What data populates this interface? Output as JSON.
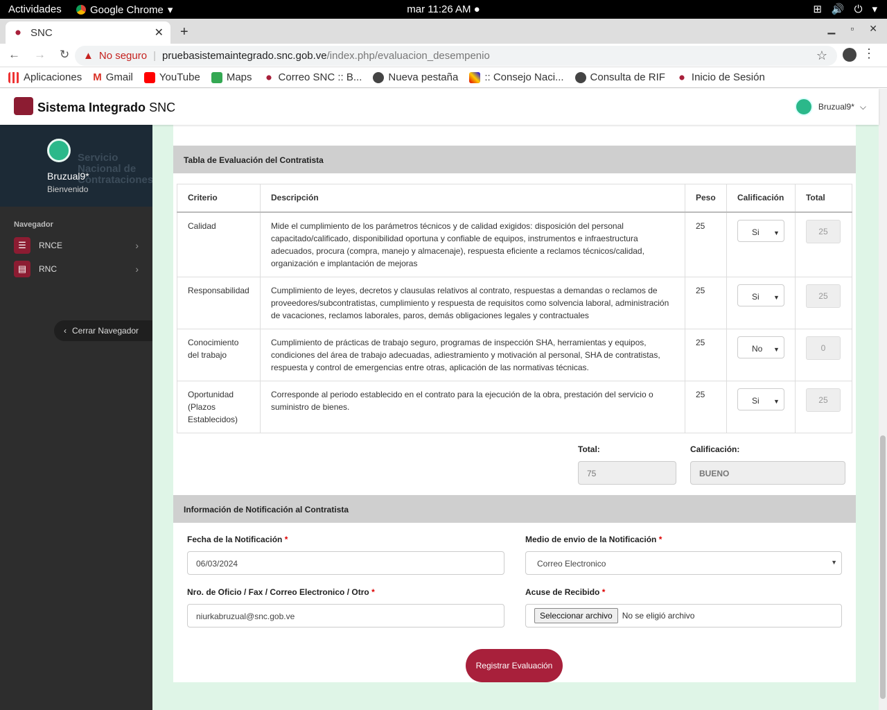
{
  "os": {
    "activities": "Actividades",
    "app_name": "Google Chrome",
    "clock": "mar 11:26 AM"
  },
  "browser": {
    "tab_title": "SNC",
    "security": "No seguro",
    "host": "pruebasistemaintegrado.snc.gob.ve",
    "path": "/index.php/evaluacion_desempenio",
    "bookmarks": [
      "Aplicaciones",
      "Gmail",
      "YouTube",
      "Maps",
      "Correo SNC :: B...",
      "Nueva pestaña",
      ":: Consejo Naci...",
      "Consulta de RIF",
      "Inicio de Sesión"
    ]
  },
  "app": {
    "brand_bold": "Sistema Integrado",
    "brand_rest": "SNC",
    "user": "Bruzual9*"
  },
  "sidebar": {
    "bg_text": [
      "Servicio",
      "Nacional de",
      "Contrataciones"
    ],
    "name": "Bruzual9*",
    "welcome": "Bienvenido",
    "nav_label": "Navegador",
    "items": [
      {
        "label": "RNCE"
      },
      {
        "label": "RNC"
      }
    ],
    "close": "Cerrar Navegador"
  },
  "eval": {
    "title": "Tabla de Evaluación del Contratista",
    "headers": [
      "Criterio",
      "Descripción",
      "Peso",
      "Calificación",
      "Total"
    ],
    "rows": [
      {
        "criterio": "Calidad",
        "descripcion": "Mide el cumplimiento de los parámetros técnicos y de calidad exigidos: disposición del personal capacitado/calificado, disponibilidad oportuna y confiable de equipos, instrumentos e infraestructura adecuados, procura (compra, manejo y almacenaje), respuesta eficiente a reclamos técnicos/calidad, organización e implantación de mejoras",
        "peso": "25",
        "calificacion": "Si",
        "total": "25"
      },
      {
        "criterio": "Responsabilidad",
        "descripcion": "Cumplimiento de leyes, decretos y clausulas relativos al contrato, respuestas a demandas o reclamos de proveedores/subcontratistas, cumplimiento y respuesta de requisitos como solvencia laboral, administración de vacaciones, reclamos laborales, paros, demás obligaciones legales y contractuales",
        "peso": "25",
        "calificacion": "Si",
        "total": "25"
      },
      {
        "criterio": "Conocimiento del trabajo",
        "descripcion": "Cumplimiento de prácticas de trabajo seguro, programas de inspección SHA, herramientas y equipos, condiciones del área de trabajo adecuadas, adiestramiento y motivación al personal, SHA de contratistas, respuesta y control de emergencias entre otras, aplicación de las normativas técnicas.",
        "peso": "25",
        "calificacion": "No",
        "total": "0"
      },
      {
        "criterio": "Oportunidad (Plazos Establecidos)",
        "descripcion": "Corresponde al periodo establecido en el contrato para la ejecución de la obra, prestación del servicio o suministro de bienes.",
        "peso": "25",
        "calificacion": "Si",
        "total": "25"
      }
    ],
    "total_label": "Total:",
    "total_value": "75",
    "grade_label": "Calificación:",
    "grade_value": "BUENO"
  },
  "notif": {
    "title": "Información de Notificación al Contratista",
    "date_label": "Fecha de la Notificación",
    "date_value": "06/03/2024",
    "medium_label": "Medio de envio de la Notificación",
    "medium_value": "Correo Electronico",
    "office_label": "Nro. de Oficio / Fax / Correo Electronico / Otro",
    "office_value": "niurkabruzual@snc.gob.ve",
    "receipt_label": "Acuse de Recibido",
    "file_button": "Seleccionar archivo",
    "file_status": "No se eligió archivo",
    "submit": "Registrar Evaluación"
  }
}
